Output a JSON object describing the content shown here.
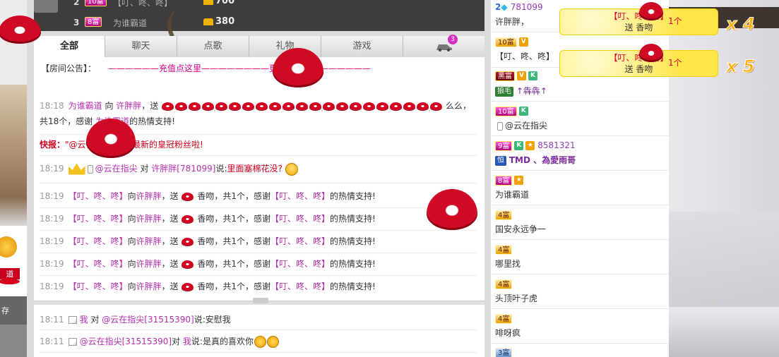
{
  "ranking": {
    "rows": [
      {
        "rank": "2",
        "level": "10富",
        "name": "【叮、咚、咚】",
        "score": "700"
      },
      {
        "rank": "3",
        "level": "8富",
        "name": "为谁霸道",
        "score": "380"
      }
    ]
  },
  "left_panel": {
    "save_label": "存",
    "badge_label": "道"
  },
  "tabs": [
    {
      "label": "全部"
    },
    {
      "label": "聊天"
    },
    {
      "label": "点歌"
    },
    {
      "label": "礼物"
    },
    {
      "label": "游戏"
    },
    {
      "label": "",
      "icon": "car-icon",
      "badge": "3"
    }
  ],
  "announcement": {
    "label": "【房间公告】：",
    "link_text": "——————充值点这里————————更多爱情————————"
  },
  "messages": [
    {
      "time": "18:18",
      "sender": "为谁霸道",
      "verb": "向",
      "target": "许胖胖",
      "send": "，送",
      "suffix": "么么，共18个，感谢",
      "thanks_name": "为谁霸道",
      "thanks_end": "的热情支持!"
    },
    {
      "flash_label": "快报：",
      "flash_text": "\"@云在指尖\"成为最新的皇冠粉丝啦!"
    },
    {
      "time": "18:19",
      "sender": "@云在指尖",
      "verb": "对",
      "target": "许胖胖",
      "id": "[781099]",
      "said": "说:",
      "content": "里面塞棉花没?"
    },
    {
      "time": "18:19",
      "sender": "【叮、咚、咚】",
      "verb": "向",
      "target": "许胖胖",
      "send": "，送",
      "gift": "香吻，共1个，感谢",
      "thanks_name": "【叮、咚、咚】",
      "thanks_end": "的热情支持!"
    },
    {
      "time": "18:19",
      "sender": "【叮、咚、咚】",
      "verb": "向",
      "target": "许胖胖",
      "send": "，送",
      "gift": "香吻，共1个，感谢",
      "thanks_name": "【叮、咚、咚】",
      "thanks_end": "的热情支持!"
    },
    {
      "time": "18:19",
      "sender": "【叮、咚、咚】",
      "verb": "向",
      "target": "许胖胖",
      "send": "，送",
      "gift": "香吻，共1个，感谢",
      "thanks_name": "【叮、咚、咚】",
      "thanks_end": "的热情支持!"
    },
    {
      "time": "18:19",
      "sender": "【叮、咚、咚】",
      "verb": "向",
      "target": "许胖胖",
      "send": "，送",
      "gift": "香吻，共1个，感谢",
      "thanks_name": "【叮、咚、咚】",
      "thanks_end": "的热情支持!"
    },
    {
      "time": "18:19",
      "sender": "【叮、咚、咚】",
      "verb": "向",
      "target": "许胖胖",
      "send": "，送",
      "gift": "香吻，共1个，感谢",
      "thanks_name": "【叮、咚、咚】",
      "thanks_end": "的热情支持!"
    }
  ],
  "private_messages": [
    {
      "time": "18:11",
      "sender": "我",
      "verb": "对",
      "target": "@云在指尖[31515390]",
      "said": "说:",
      "content": "安慰我"
    },
    {
      "time": "18:11",
      "sender": "@云在指尖[31515390]",
      "verb": "对",
      "target": "我",
      "said": "说:",
      "content": "是真的喜欢你"
    }
  ],
  "users": [
    {
      "rank": "2",
      "id": "781099",
      "name": "许胖胖，"
    },
    {
      "level": "10富",
      "name": "【叮、咚、咚】"
    },
    {
      "level": "黑富",
      "tag": "狼毛",
      "name": "↑犇犇↑"
    },
    {
      "level": "10富",
      "name": "@云在指尖"
    },
    {
      "level": "9富",
      "id": "8581321",
      "tag": "恒",
      "name": "TMD 、為愛雨哥"
    },
    {
      "level": "8富",
      "name": "为谁霸道"
    },
    {
      "level": "4富",
      "name": "国安永远争一"
    },
    {
      "level": "4富",
      "name": "哪里找"
    },
    {
      "level": "4富",
      "name": "头顶叶子虎"
    },
    {
      "level": "4富",
      "name": "啡呀疯"
    },
    {
      "level": "3富",
      "name": ""
    }
  ],
  "gift_banners": [
    {
      "name": "【叮、咚、咚】",
      "action": "送 香吻",
      "count": "1个",
      "multiplier": "x 4"
    },
    {
      "name": "【叮、咚、咚】",
      "action": "送 香吻",
      "count": "1个",
      "multiplier": "x 5"
    }
  ],
  "colors": {
    "accent": "#d0008c",
    "name": "#b62fb2",
    "kiss": "#d4001f",
    "multiplier": "#ffae00"
  }
}
